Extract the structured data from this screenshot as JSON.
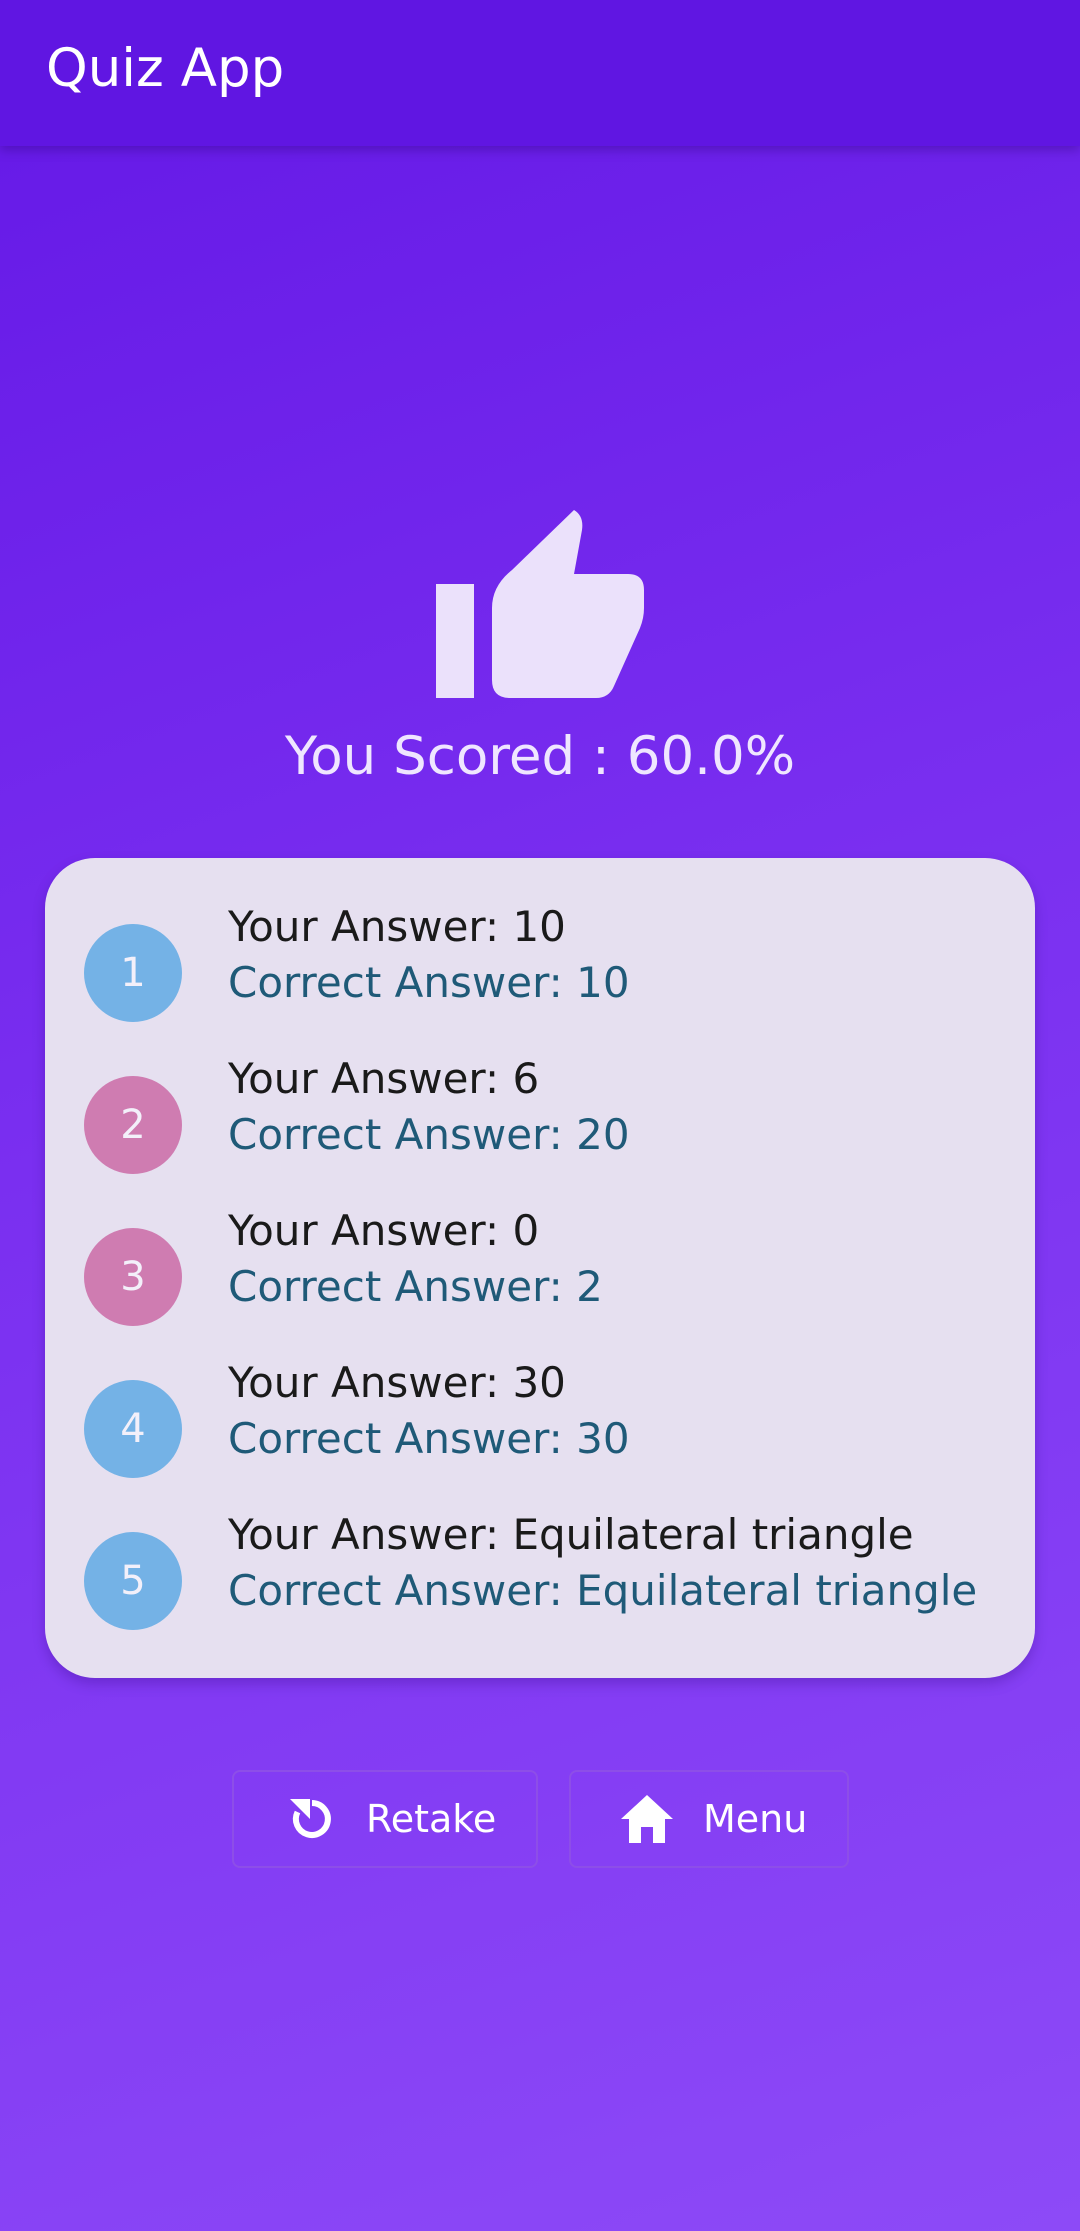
{
  "appbar": {
    "title": "Quiz App"
  },
  "result": {
    "score_text": "You Scored : 60.0%"
  },
  "answers": [
    {
      "number": "1",
      "your": "Your Answer: 10",
      "correct": "Correct Answer: 10",
      "color": "#74b2e6"
    },
    {
      "number": "2",
      "your": "Your Answer: 6",
      "correct": "Correct Answer: 20",
      "color": "#cf7cb1"
    },
    {
      "number": "3",
      "your": "Your Answer: 0",
      "correct": "Correct Answer: 2",
      "color": "#cf7cb1"
    },
    {
      "number": "4",
      "your": "Your Answer: 30",
      "correct": "Correct Answer: 30",
      "color": "#74b2e6"
    },
    {
      "number": "5",
      "your": "Your Answer: Equilateral triangle",
      "correct": "Correct Answer: Equilateral triangle",
      "color": "#74b2e6"
    }
  ],
  "buttons": {
    "retake": {
      "label": "Retake",
      "icon": "refresh-icon"
    },
    "menu": {
      "label": "Menu",
      "icon": "home-icon"
    }
  },
  "colors": {
    "appbar": "#6016e2",
    "correct_circle": "#74b2e6",
    "wrong_circle": "#cf7cb1",
    "card": "#e6e0f0",
    "correct_text": "#1f5a78"
  }
}
